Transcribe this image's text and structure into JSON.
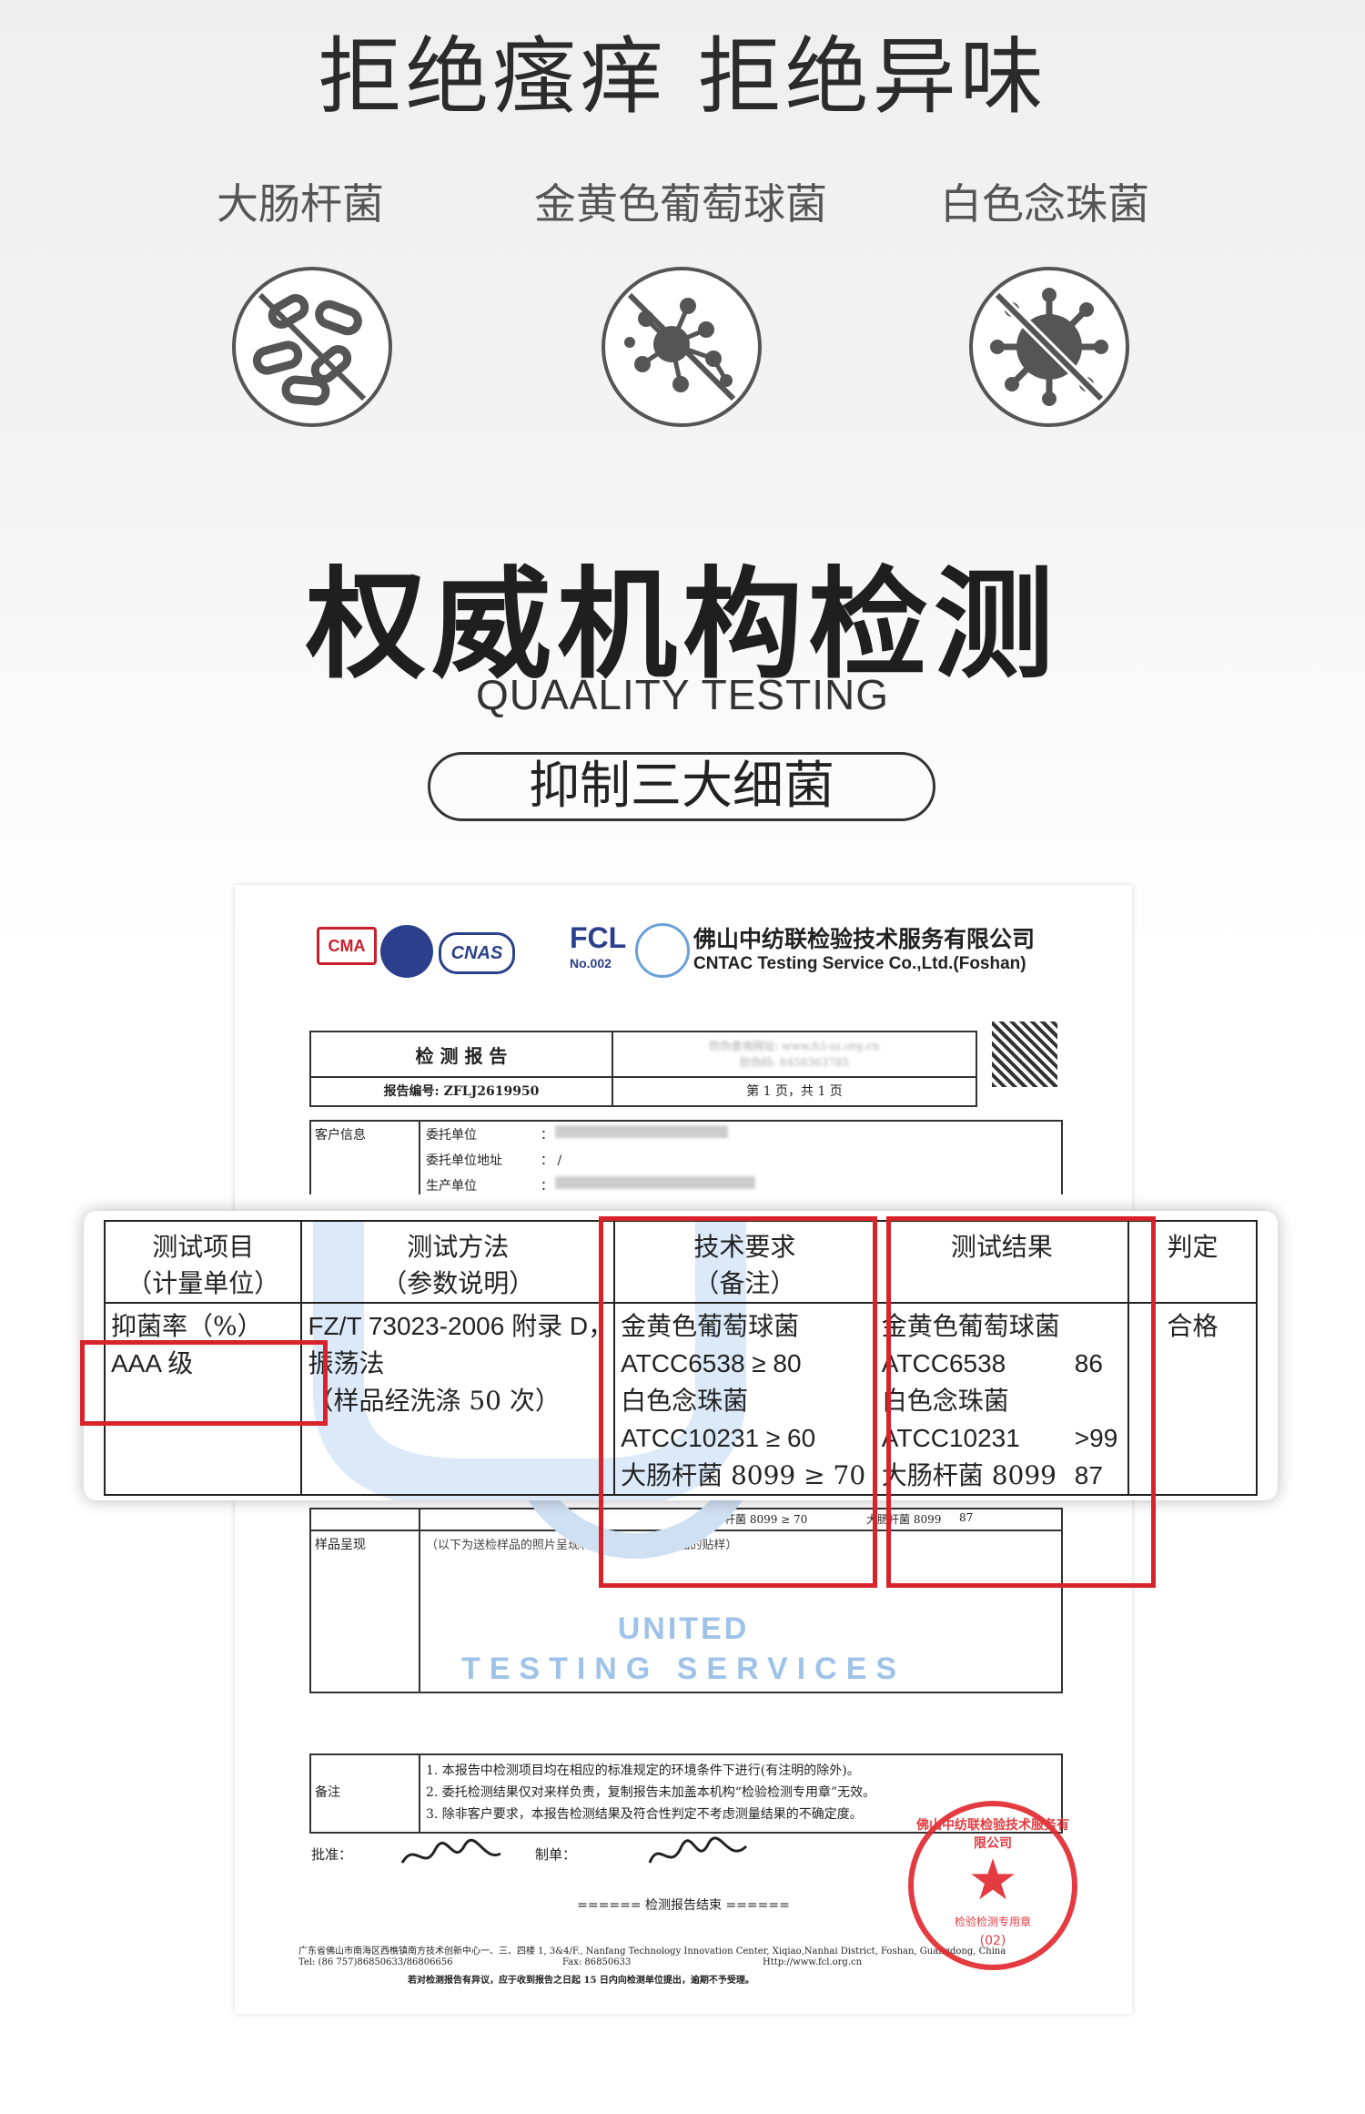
{
  "top_heading": "拒绝瘙痒 拒绝异味",
  "bacteria": [
    {
      "label": "大肠杆菌",
      "icon": "rod-bacteria-crossed-icon"
    },
    {
      "label": "金黄色葡萄球菌",
      "icon": "cocci-bacteria-crossed-icon"
    },
    {
      "label": "白色念珠菌",
      "icon": "virus-crossed-icon"
    }
  ],
  "main_heading": "权威机构检测",
  "subheading": "QUAALITY TESTING",
  "pill_label": "抑制三大细菌",
  "document": {
    "company_cn": "佛山中纺联检验技术服务有限公司",
    "company_en": "CNTAC Testing Service Co.,Ltd.(Foshan)",
    "logo_texts": [
      "CMA",
      "CNAS",
      "FCL",
      "No.002"
    ],
    "report_title": "检 测 报 告",
    "report_no": "报告编号: ZFLJ2619950",
    "query_site": "防伪查询网址: www.fcl-sz.org.cn",
    "query_code": "防伪码: 8458363785",
    "page_info": "第 1 页，共 1 页",
    "client_info_label": "客户信息",
    "client_rows": [
      "委托单位",
      "委托单位地址",
      "生产单位"
    ],
    "client_values": [
      "：",
      "： /",
      "："
    ],
    "sample_label": "样品呈现",
    "sample_note": "（以下为送检样品的照片呈现和/或裁剪自送检样品的贴样）",
    "watermark_top": "UNITED",
    "watermark_arc": "TESTING SERVICES",
    "remarks_label": "备注",
    "remarks": [
      "1.  本报告中检测项目均在相应的标准规定的环境条件下进行(有注明的除外)。",
      "2.  委托检测结果仅对来样负责，复制报告未加盖本机构“检验检测专用章”无效。",
      "3.  除非客户要求，本报告检测结果及符合性判定不考虑测量结果的不确定度。"
    ],
    "approve_label": "批准：",
    "make_label": "制单：",
    "end_text": "====== 检测报告结束 ======",
    "address": "广东省佛山市南海区西樵镇南方技术创新中心一、三、四楼 1, 3&4/F., Nanfang Technology Innovation Center, Xiqiao,Nanhai District, Foshan, Guangdong, China",
    "tel": "Tel: (86 757)86850633/86806656",
    "fax": "Fax: 86850633",
    "web": "Http://www.fcl.org.cn",
    "footer_note": "若对检测报告有异议，应于收到报告之日起 15 日内向检测单位提出，逾期不予受理。",
    "strip_text1": "大肠杆菌 8099 ≥ 70",
    "strip_text2": "大肠杆菌 8099",
    "strip_val": "87",
    "stamp_text": "佛山中纺联检验技术服务有限公司",
    "stamp_sub": "检验检测专用章",
    "stamp_num": "(02)"
  },
  "table": {
    "headers": [
      [
        "测试项目",
        "（计量单位）"
      ],
      [
        "测试方法",
        "（参数说明）"
      ],
      [
        "技术要求",
        "（备注）"
      ],
      [
        "测试结果"
      ],
      [
        "判定"
      ]
    ],
    "row": {
      "item": [
        "抑菌率（%）",
        "AAA 级"
      ],
      "method": [
        "FZ/T 73023-2006 附录 D，",
        "振荡法",
        "（样品经洗涤 50 次）"
      ],
      "requirements": [
        "金黄色葡萄球菌",
        "ATCC6538 ≥ 80",
        "白色念珠菌",
        "ATCC10231 ≥ 60",
        "大肠杆菌 8099 ≥ 70"
      ],
      "results": [
        {
          "name": "金黄色葡萄球菌",
          "value": ""
        },
        {
          "name": "ATCC6538",
          "value": "86"
        },
        {
          "name": "白色念珠菌",
          "value": ""
        },
        {
          "name": "ATCC10231",
          "value": ">99"
        },
        {
          "name": "大肠杆菌 8099",
          "value": "87"
        }
      ],
      "judgment": "合格"
    }
  },
  "colors": {
    "highlight_red": "#d8232a",
    "watermark_blue": "#9fc3e8",
    "stamp_red": "#e0262c"
  }
}
